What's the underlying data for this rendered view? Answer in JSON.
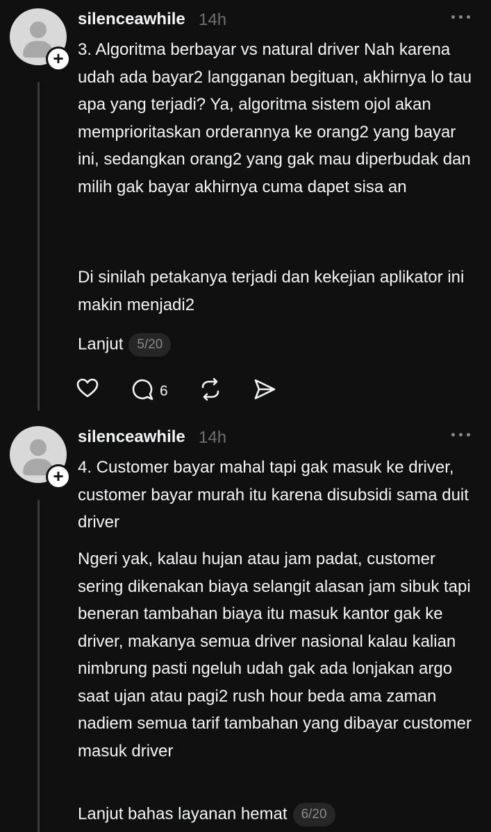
{
  "posts": [
    {
      "username": "silenceawhile",
      "time": "14h",
      "paragraph1": "3. Algoritma berbayar vs natural driver Nah karena udah ada bayar2 langganan begituan, akhirnya lo tau apa yang terjadi? Ya, algoritma sistem ojol akan memprioritaskan orderannya ke orang2 yang bayar ini, sedangkan orang2 yang gak mau diperbudak dan milih gak bayar akhirnya cuma dapet sisa an",
      "paragraph2": "Di sinilah petakanya terjadi dan kekejian aplikator ini makin menjadi2",
      "continue_label": "Lanjut",
      "counter": "5/20",
      "reply_count": "6"
    },
    {
      "username": "silenceawhile",
      "time": "14h",
      "paragraph1": "4. Customer bayar mahal tapi gak masuk ke driver, customer bayar murah itu karena disubsidi sama duit driver",
      "paragraph2": "Ngeri yak, kalau hujan atau jam padat, customer sering dikenakan biaya selangit alasan jam sibuk tapi beneran tambahan biaya itu masuk kantor gak ke driver, makanya semua driver nasional kalau kalian nimbrung pasti ngeluh udah gak ada lonjakan argo saat ujan atau pagi2 rush hour beda ama zaman nadiem semua tarif tambahan yang dibayar customer masuk driver",
      "continue_label": "Lanjut bahas layanan hemat",
      "counter": "6/20"
    }
  ],
  "icons": [
    "user-avatar-icon",
    "plus-icon",
    "more-icon",
    "heart-icon",
    "comment-icon",
    "repost-icon",
    "share-icon"
  ],
  "colors": {
    "background": "#101010",
    "text": "#f3f5f7",
    "muted": "#6f6f6f",
    "badge_bg": "#262626"
  }
}
